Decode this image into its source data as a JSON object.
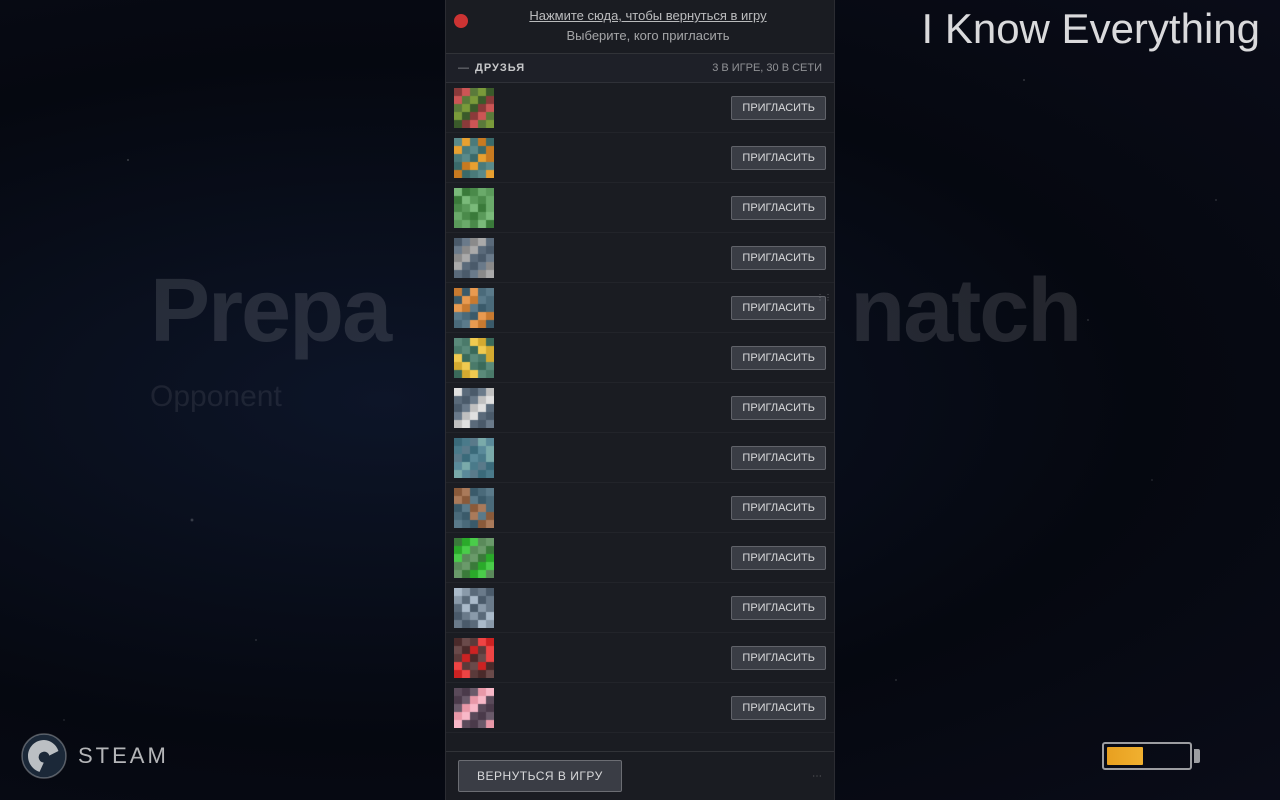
{
  "background": {
    "title": "Prepa                     natch",
    "subtitle": "Opponent                    OT READY"
  },
  "top_right": {
    "title": "I Know Everything"
  },
  "overlay": {
    "click_to_return": "Нажмите сюда, чтобы вернуться в игру",
    "choose_label": "Выберите, кого пригласить",
    "friends_section": {
      "label": "ДРУЗЬЯ",
      "count": "3 В ИГРЕ, 30 В СЕТИ",
      "collapse": "—"
    },
    "invite_label": "ПРИГЛАСИТЬ",
    "return_button": "ВЕРНУТЬСЯ В ИГРУ"
  },
  "steam": {
    "text": "STEAM"
  },
  "friends": [
    {
      "id": 1,
      "colors": [
        "#8b3a3a",
        "#5a7a3a",
        "#3a5a3a",
        "#5a6a2a"
      ]
    },
    {
      "id": 2,
      "colors": [
        "#c87a20",
        "#5a8a8a",
        "#4a7a7a",
        "#3a6a6a"
      ]
    },
    {
      "id": 3,
      "colors": [
        "#3a8a3a",
        "#4a7a4a",
        "#5a8a5a",
        "#6a9a6a"
      ]
    },
    {
      "id": 4,
      "colors": [
        "#8a8a8a",
        "#5a6a7a",
        "#4a5a6a",
        "#6a7a8a"
      ]
    },
    {
      "id": 5,
      "colors": [
        "#c87a30",
        "#5a7a8a",
        "#4a6a7a",
        "#3a5a6a"
      ]
    },
    {
      "id": 6,
      "colors": [
        "#d4aa30",
        "#5a8a7a",
        "#4a7a6a",
        "#3a6a5a"
      ]
    },
    {
      "id": 7,
      "colors": [
        "#b0b0b0",
        "#5a6a7a",
        "#4a5a6a",
        "#6a7a8a"
      ]
    },
    {
      "id": 8,
      "colors": [
        "#5a8a9a",
        "#4a7a8a",
        "#3a6a7a",
        "#5a7a8a"
      ]
    },
    {
      "id": 9,
      "colors": [
        "#8a5a3a",
        "#5a7a8a",
        "#4a6a7a",
        "#3a5a6a"
      ]
    },
    {
      "id": 10,
      "colors": [
        "#3aaa3a",
        "#4a8a4a",
        "#5a7a5a",
        "#6a8a6a"
      ]
    },
    {
      "id": 11,
      "colors": [
        "#8a9aaa",
        "#5a6a7a",
        "#4a5a6a",
        "#6a7a8a"
      ]
    },
    {
      "id": 12,
      "colors": [
        "#cc2222",
        "#5a3a3a",
        "#4a2a2a",
        "#6a4a4a"
      ]
    },
    {
      "id": 13,
      "colors": [
        "#f0a0b0",
        "#5a4a5a",
        "#4a3a4a",
        "#6a5a6a"
      ]
    }
  ]
}
